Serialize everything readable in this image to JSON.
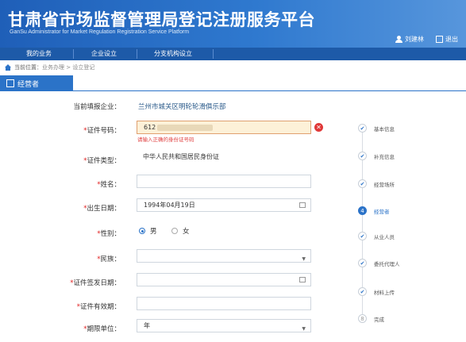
{
  "header": {
    "title": "甘肃省市场监督管理局登记注册服务平台",
    "subtitle": "GanSu Administrator for Market Regulation Registration Service Platform",
    "user_name": "刘建林",
    "logout_label": "退出"
  },
  "nav": {
    "items": [
      {
        "label": "我的业务"
      },
      {
        "label": "企业设立"
      },
      {
        "label": "分支机构设立"
      }
    ]
  },
  "breadcrumb": {
    "prefix": "当前位置：",
    "path": "业务办理 > 设立登记"
  },
  "section_tab": {
    "label": "经营者"
  },
  "form": {
    "enterprise_label": "当前填报企业：",
    "enterprise_value": "兰州市城关区明轮轮滑俱乐部",
    "id_number_label": "*证件号码：",
    "id_number_value": "612",
    "id_number_error": "请输入正确的身份证号码",
    "id_type_label": "*证件类型：",
    "id_type_value": "中华人民共和国居民身份证",
    "name_label": "*姓名：",
    "name_value": "",
    "birth_label": "*出生日期：",
    "birth_value": "1994年04月19日",
    "gender_label": "*性别：",
    "gender_male": "男",
    "gender_female": "女",
    "ethnicity_label": "*民族：",
    "ethnicity_value": "",
    "issue_date_label": "*证件签发日期：",
    "issue_date_value": "",
    "validity_label": "*证件有效期：",
    "validity_value": "",
    "term_unit_label": "*期限单位：",
    "term_unit_value": "年"
  },
  "steps": [
    {
      "label": "基本信息",
      "status": "done",
      "mark": "✔"
    },
    {
      "label": "补充信息",
      "status": "done",
      "mark": "✔"
    },
    {
      "label": "经营场所",
      "status": "done",
      "mark": "✔"
    },
    {
      "label": "经营者",
      "status": "active",
      "mark": "4"
    },
    {
      "label": "从业人员",
      "status": "done",
      "mark": "✔"
    },
    {
      "label": "委托代理人",
      "status": "done",
      "mark": "✔"
    },
    {
      "label": "材料上传",
      "status": "done",
      "mark": "✔"
    },
    {
      "label": "完成",
      "status": "todo",
      "mark": "8"
    }
  ],
  "colors": {
    "header_blue": "#2a6fc3",
    "nav_blue": "#1d5aa8",
    "required_red": "#e02020",
    "error_bg": "#fdf1d8"
  }
}
